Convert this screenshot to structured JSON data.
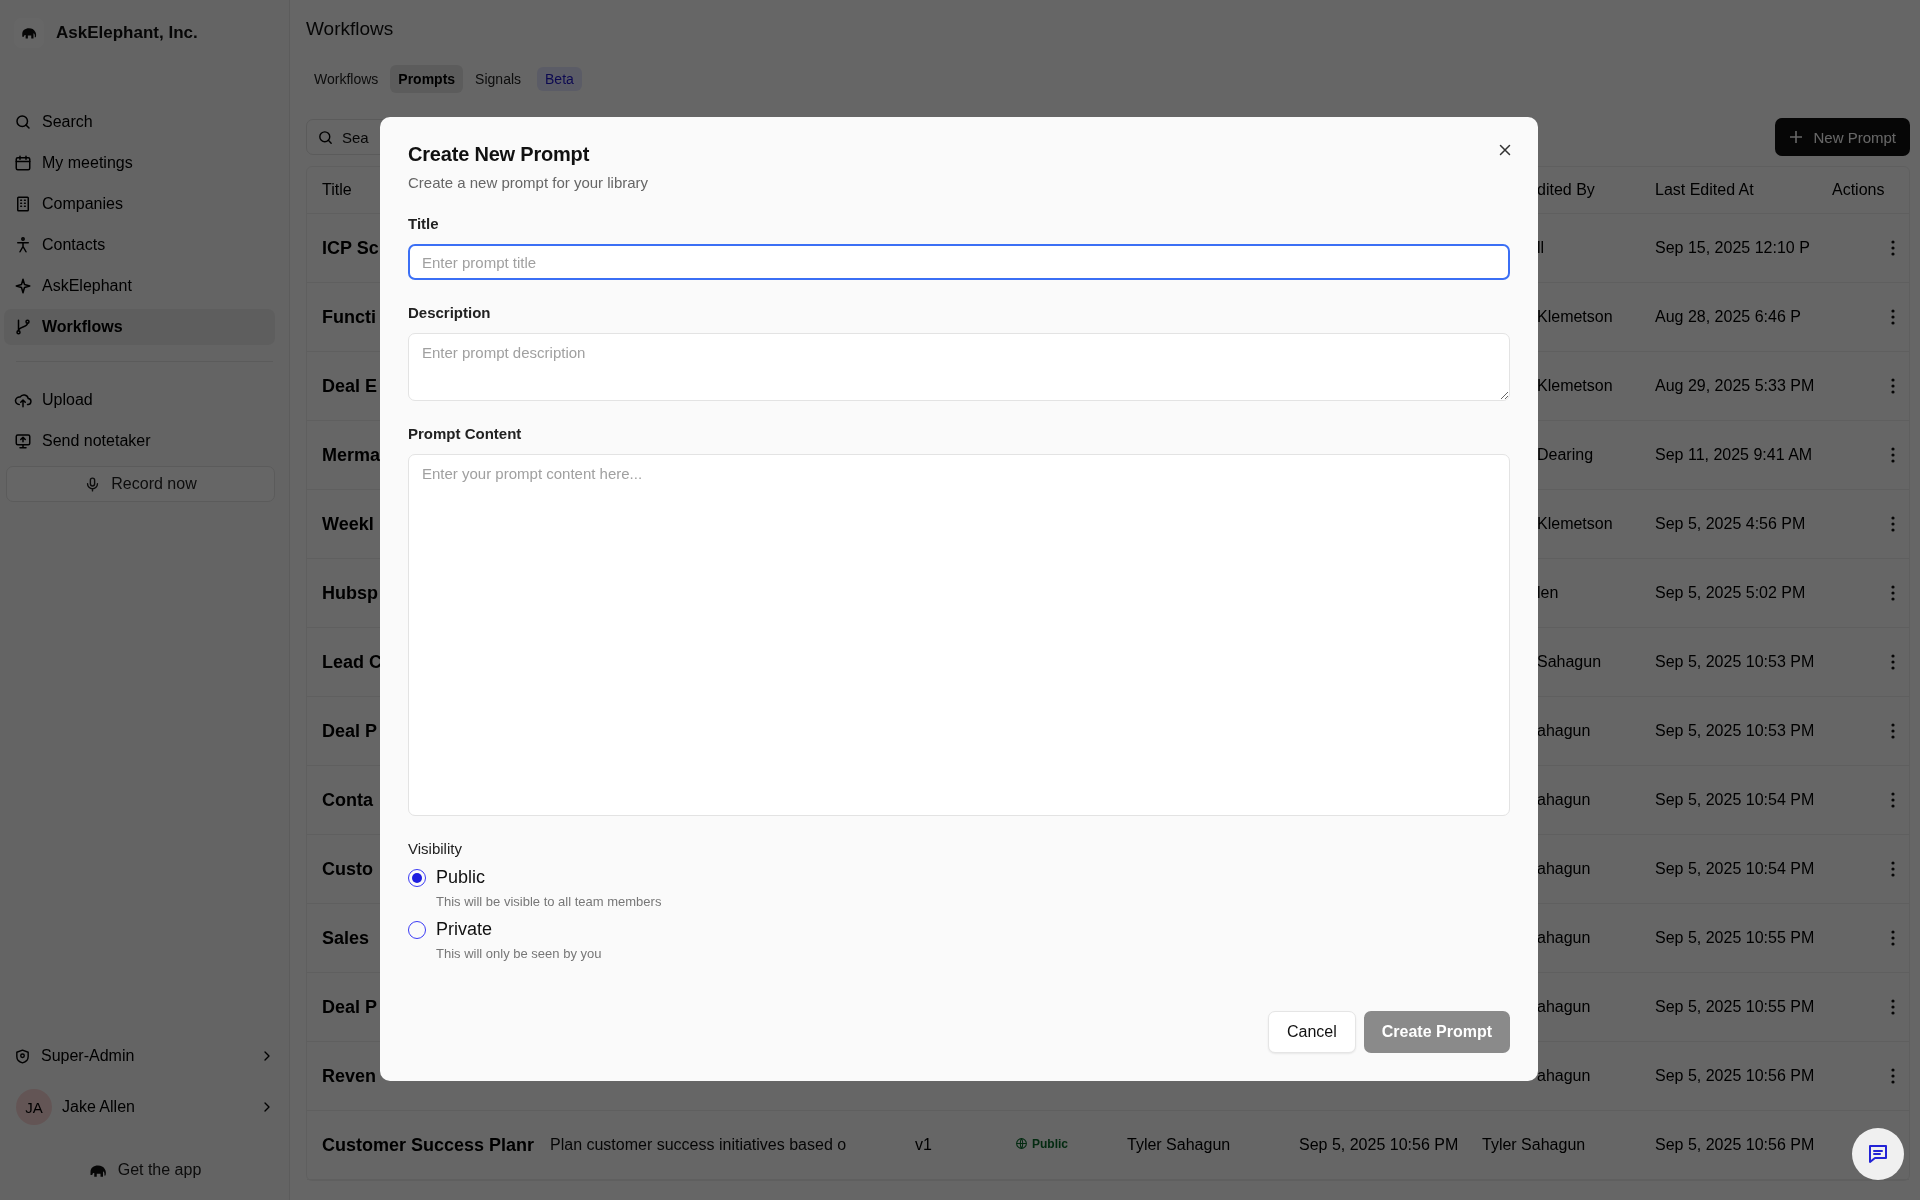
{
  "sidebar": {
    "org_name": "AskElephant, Inc.",
    "nav_items": [
      {
        "label": "Search",
        "selected": false
      },
      {
        "label": "My meetings",
        "selected": false
      },
      {
        "label": "Companies",
        "selected": false
      },
      {
        "label": "Contacts",
        "selected": false
      },
      {
        "label": "AskElephant",
        "selected": false
      },
      {
        "label": "Workflows",
        "selected": true
      }
    ],
    "action_items": [
      {
        "label": "Upload"
      },
      {
        "label": "Send notetaker"
      }
    ],
    "record_button": "Record now",
    "admin_item": "Super-Admin",
    "user": {
      "initials": "JA",
      "name": "Jake Allen"
    },
    "get_app": "Get the app"
  },
  "page_title": "Workflows",
  "tabs": [
    {
      "label": "Workflows",
      "selected": false
    },
    {
      "label": "Prompts",
      "selected": true
    },
    {
      "label": "Signals",
      "selected": false
    }
  ],
  "beta_badge": "Beta",
  "search": {
    "placeholder": "Sea"
  },
  "new_prompt_button": "New Prompt",
  "table": {
    "header": {
      "kind": "covered",
      "title": "Title",
      "edited_by": "dited By",
      "edited_at": "Last Edited At",
      "actions": "Actions"
    },
    "rows": [
      {
        "kind": "covered",
        "title": "ICP Sc",
        "edited_by": "ll",
        "edited_at": "Sep 15, 2025 12:10 P"
      },
      {
        "kind": "covered",
        "title": "Functi",
        "edited_by": "Klemetson",
        "edited_at": "Aug 28, 2025 6:46 P"
      },
      {
        "kind": "covered",
        "title": "Deal E",
        "edited_by": "Klemetson",
        "edited_at": "Aug 29, 2025 5:33 PM"
      },
      {
        "kind": "covered",
        "title": "Merma",
        "edited_by": "Dearing",
        "edited_at": "Sep 11, 2025 9:41 AM"
      },
      {
        "kind": "covered",
        "title": "Weekl",
        "edited_by": "Klemetson",
        "edited_at": "Sep 5, 2025 4:56 PM"
      },
      {
        "kind": "covered",
        "title": "Hubsp",
        "edited_by": "len",
        "edited_at": "Sep 5, 2025 5:02 PM"
      },
      {
        "kind": "covered",
        "title": "Lead C",
        "edited_by": "Sahagun",
        "edited_at": "Sep 5, 2025 10:53 PM"
      },
      {
        "kind": "covered",
        "title": "Deal P",
        "edited_by": "ahagun",
        "edited_at": "Sep 5, 2025 10:53 PM"
      },
      {
        "kind": "covered",
        "title": "Conta",
        "edited_by": "ahagun",
        "edited_at": "Sep 5, 2025 10:54 PM"
      },
      {
        "kind": "covered",
        "title": "Custo",
        "edited_by": "ahagun",
        "edited_at": "Sep 5, 2025 10:54 PM"
      },
      {
        "kind": "covered",
        "title": "Sales",
        "edited_by": "ahagun",
        "edited_at": "Sep 5, 2025 10:55 PM"
      },
      {
        "kind": "covered",
        "title": "Deal P",
        "edited_by": "ahagun",
        "edited_at": "Sep 5, 2025 10:55 PM"
      },
      {
        "kind": "covered",
        "title": "Reven",
        "edited_by": "ahagun",
        "edited_at": "Sep 5, 2025 10:56 PM"
      },
      {
        "kind": "full",
        "title": "Customer Success Planr",
        "description": "Plan customer success initiatives based o",
        "version": "v1",
        "visibility": "Public",
        "created_by": "Tyler Sahagun",
        "created_at": "Sep 5, 2025 10:56 PM",
        "edited_by": "Tyler Sahagun",
        "edited_at": "Sep 5, 2025 10:56 PM"
      }
    ]
  },
  "dialog": {
    "title": "Create New Prompt",
    "subtitle": "Create a new prompt for your library",
    "fields": [
      {
        "kind": "input",
        "label": "Title",
        "placeholder": "Enter prompt title",
        "focused": true
      },
      {
        "kind": "textarea",
        "label": "Description",
        "placeholder": "Enter prompt description",
        "focused": false
      },
      {
        "kind": "content",
        "label": "Prompt Content",
        "placeholder": "Enter your prompt content here...",
        "focused": false
      }
    ],
    "visibility": {
      "label": "Visibility",
      "options": [
        {
          "label": "Public",
          "hint": "This will be visible to all team members",
          "selected": true
        },
        {
          "label": "Private",
          "hint": "This will only be seen by you",
          "selected": false
        }
      ]
    },
    "cancel_button": "Cancel",
    "create_button": "Create Prompt"
  }
}
